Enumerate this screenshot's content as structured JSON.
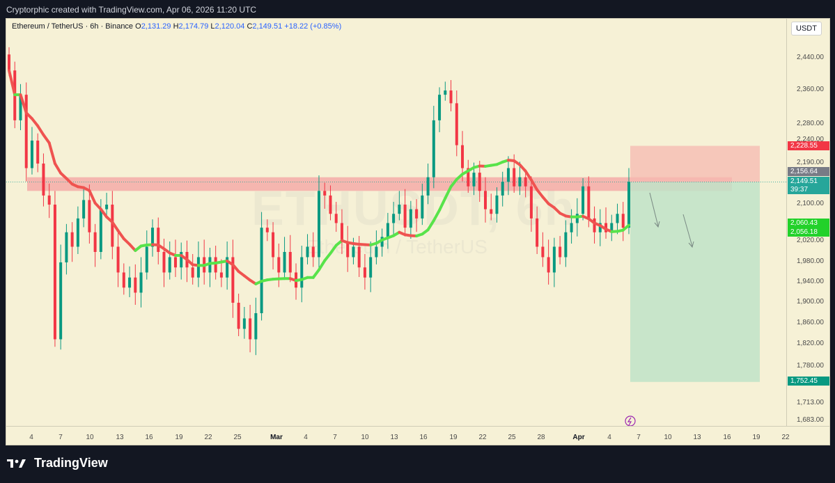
{
  "header": {
    "credit": "Cryptorphic created with TradingView.com, Apr 06, 2026 11:20 UTC"
  },
  "legend": {
    "symbol": "Ethereum / TetherUS · 6h · Binance",
    "o_label": "O",
    "o_value": "2,131.29",
    "h_label": "H",
    "h_value": "2,174.79",
    "l_label": "L",
    "l_value": "2,120.04",
    "c_label": "C",
    "c_value": "2,149.51",
    "change": "+18.22 (+0.85%)"
  },
  "watermark": {
    "symbol": "ETHUSDT, 6h",
    "name": "Ethereum / TetherUS"
  },
  "price_axis": {
    "currency": "USDT",
    "ticks": [
      "2,440.00",
      "2,360.00",
      "2,280.00",
      "2,240.00",
      "2,190.00",
      "2,100.00",
      "2,020.00",
      "1,980.00",
      "1,940.00",
      "1,900.00",
      "1,860.00",
      "1,820.00",
      "1,780.00",
      "1,713.00",
      "1,683.00"
    ],
    "labels": {
      "target_high": "2,228.55",
      "level_a": "2,156.64",
      "last_price": "2,149.51",
      "countdown": "39:37",
      "ma_a": "2,060.43",
      "ma_b": "2,056.18",
      "target_low": "1,752.45"
    }
  },
  "time_axis": {
    "ticks": [
      "4",
      "7",
      "10",
      "13",
      "16",
      "19",
      "22",
      "25",
      "Mar",
      "4",
      "7",
      "10",
      "13",
      "16",
      "19",
      "22",
      "25",
      "28",
      "Apr",
      "4",
      "7",
      "10",
      "13",
      "16",
      "19",
      "22"
    ]
  },
  "chart_data": {
    "type": "candlestick",
    "symbol": "ETHUSDT",
    "interval": "6h",
    "exchange": "Binance",
    "ylim": [
      1683,
      2480
    ],
    "resistance_zone": [
      2130,
      2160
    ],
    "position": {
      "side": "short",
      "entry": 2149.51,
      "stop": 2228.55,
      "target": 1752.45
    },
    "moving_average_colors": {
      "up": "#58e34a",
      "down": "#ef5350"
    },
    "close_series_approx": [
      2410,
      2290,
      2350,
      2180,
      2240,
      2190,
      2120,
      2100,
      1830,
      1980,
      2040,
      2010,
      2070,
      2110,
      2040,
      2000,
      2090,
      2100,
      2010,
      1960,
      1930,
      1950,
      1920,
      1960,
      2010,
      2050,
      2000,
      1960,
      1990,
      1970,
      2000,
      1970,
      1950,
      1990,
      1960,
      1990,
      1960,
      1950,
      1990,
      1900,
      1850,
      1870,
      1830,
      1880,
      2050,
      2040,
      1990,
      1960,
      2000,
      1960,
      1930,
      1990,
      2010,
      1990,
      2130,
      2120,
      2080,
      2060,
      2020,
      1990,
      2010,
      1970,
      1950,
      1990,
      2010,
      2030,
      2060,
      2080,
      2100,
      2050,
      2090,
      2070,
      2120,
      2160,
      2290,
      2350,
      2360,
      2330,
      2230,
      2180,
      2140,
      2170,
      2130,
      2090,
      2080,
      2120,
      2150,
      2180,
      2140,
      2160,
      2140,
      2070,
      2010,
      1990,
      1960,
      2010,
      1990,
      2040,
      2060,
      2080,
      2140,
      2070,
      2040,
      2060,
      2040,
      2060,
      2080,
      2050,
      2150
    ]
  }
}
